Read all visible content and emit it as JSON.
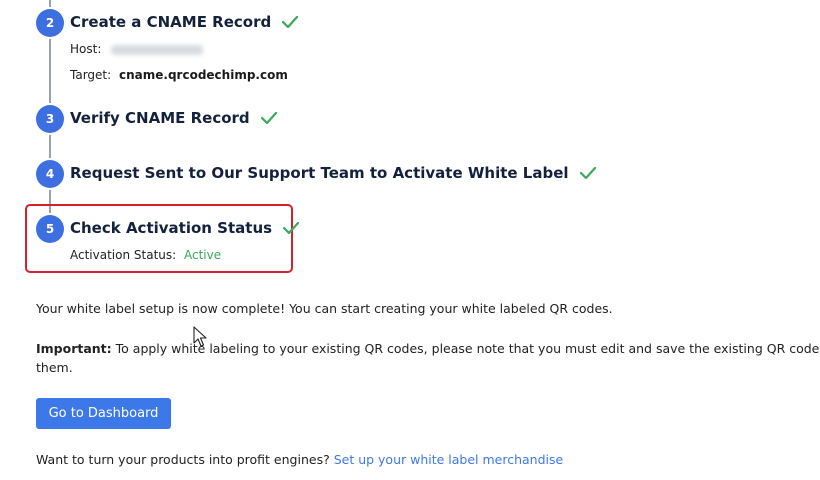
{
  "steps": [
    {
      "number": "2",
      "title": "Create a CNAME Record",
      "host_label": "Host:",
      "target_label": "Target:",
      "target_value": "cname.qrcodechimp.com"
    },
    {
      "number": "3",
      "title": "Verify CNAME Record"
    },
    {
      "number": "4",
      "title": "Request Sent to Our Support Team to Activate White Label"
    },
    {
      "number": "5",
      "title": "Check Activation Status",
      "status_label": "Activation Status:",
      "status_value": "Active"
    }
  ],
  "completion_message": "Your white label setup is now complete! You can start creating your white labeled QR codes.",
  "important": {
    "label": "Important:",
    "text_line1": " To apply white labeling to your existing QR codes, please note that you must edit and save the existing QR codes",
    "text_line2": "them."
  },
  "dashboard_button": "Go to Dashboard",
  "merch": {
    "text": "Want to turn your products into profit engines?",
    "link": "Set up your white label merchandise"
  },
  "colors": {
    "step_badge": "#3d6fe0",
    "check": "#3aa859",
    "highlight_border": "#d2222d",
    "button": "#3d78e8",
    "link": "#3d78e8"
  },
  "icons": {
    "completed": "check-icon",
    "cursor": "mouse-pointer-icon"
  }
}
